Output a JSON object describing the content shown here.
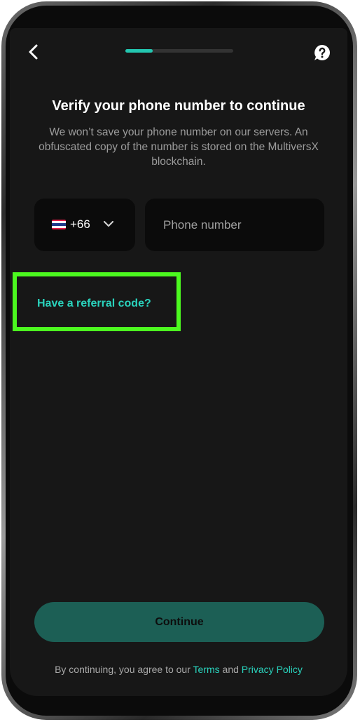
{
  "header": {
    "back_icon": "chevron-left-icon",
    "help_icon": "question-bubble-icon",
    "progress": 0.25,
    "accent_color": "#23c6b0"
  },
  "main": {
    "title": "Verify your phone number to continue",
    "subtitle": "We won’t save your phone number on our servers. An obfuscated copy of the number is stored on the MultiversX blockchain.",
    "country": {
      "flag_icon": "thailand-flag-icon",
      "dial_code": "+66"
    },
    "phone": {
      "value": "",
      "placeholder": "Phone number"
    },
    "referral_label": "Have a referral code?",
    "highlight_color": "#4cf91f"
  },
  "footer": {
    "continue_label": "Continue",
    "legal_prefix": "By continuing, you agree to our ",
    "terms_label": "Terms",
    "legal_and": " and ",
    "privacy_label": "Privacy Policy"
  }
}
